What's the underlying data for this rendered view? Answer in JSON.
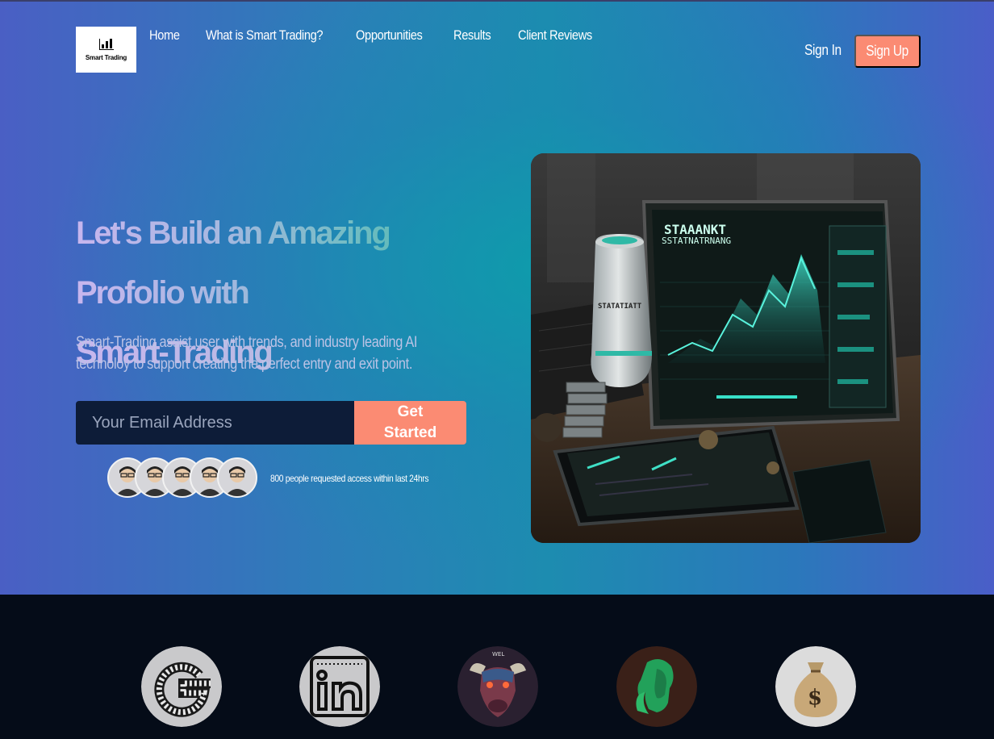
{
  "brand": {
    "logo_text": "Smart Trading"
  },
  "nav": {
    "links": [
      "Home",
      "What is Smart Trading?",
      "Opportunities",
      "Results",
      "Client Reviews"
    ],
    "sign_in": "Sign In",
    "sign_up": "Sign Up"
  },
  "hero": {
    "headline_line1": "Let's Build an Amazing Profolio with",
    "headline_line2": "Smart-Trading",
    "subtitle": "Smart-Trading assist user with trends, and industry leading AI technoloy to support creating the perfect entry and exit point.",
    "email_placeholder": "Your Email Address",
    "cta_label": "Get Started",
    "access_note": "800 people requested access within last 24hrs",
    "image_texts": {
      "screen_title": "STAAANKT",
      "screen_subtitle": "SSTATNATRNANG",
      "can_label": "STATATIATT"
    }
  },
  "partners": [
    "google-icon",
    "linkedin-icon",
    "bull-logo",
    "green-head-logo",
    "money-bag-icon"
  ],
  "colors": {
    "accent": "#fb8b73",
    "footer_bg": "#050c18",
    "input_bg": "#0d1c38"
  }
}
